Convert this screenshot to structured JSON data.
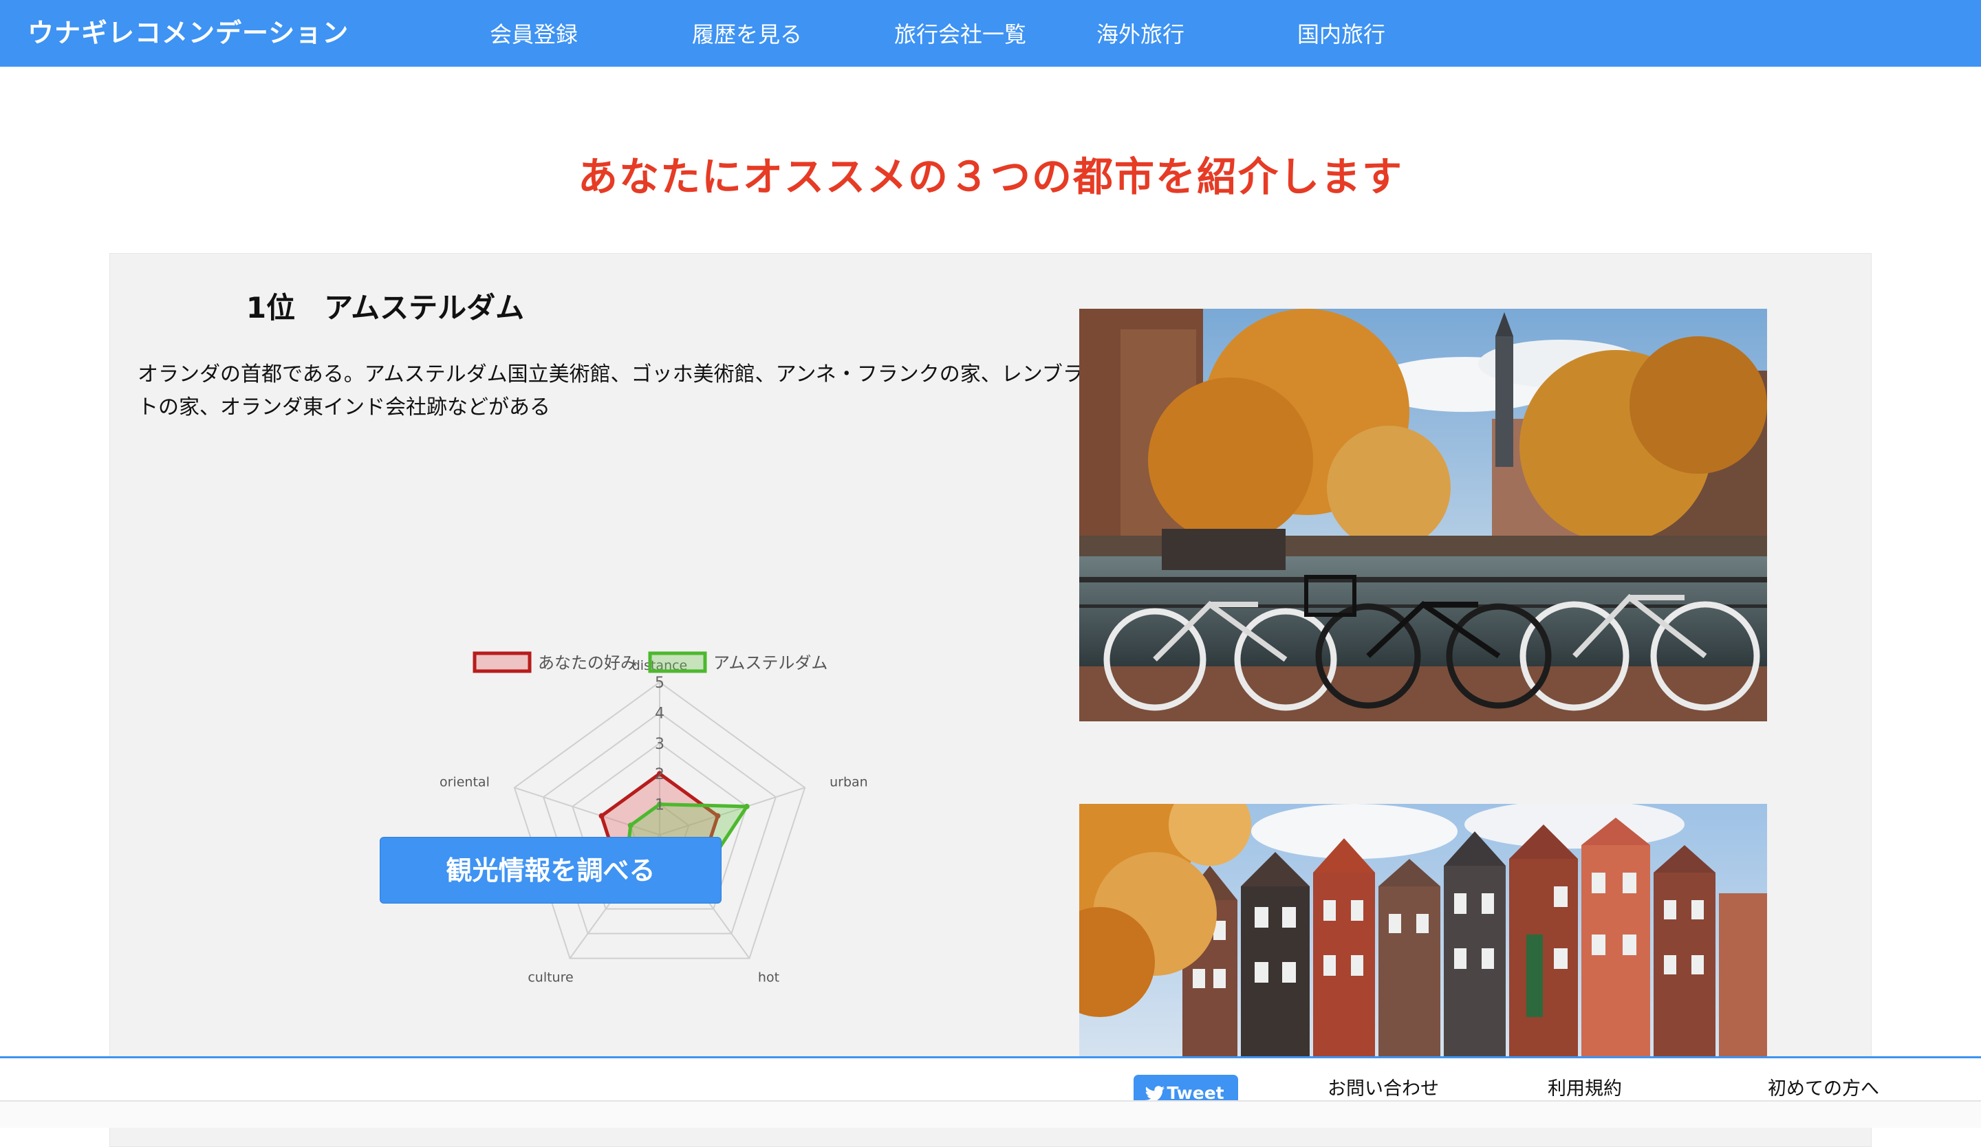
{
  "header": {
    "brand": "ウナギレコメンデーション",
    "nav": [
      "会員登録",
      "履歴を見る",
      "旅行会社一覧",
      "海外旅行",
      "国内旅行"
    ]
  },
  "headline": "あなたにオススメの３つの都市を紹介します",
  "recommendation": {
    "rank_title": "1位　アムステルダム",
    "description": "オランダの首都である。アムステルダム国立美術館、ゴッホ美術館、アンネ・フランクの家、レンブラントの家、オランダ東インド会社跡などがある",
    "cta_label": "観光情報を調べる",
    "photos": [
      "amsterdam-canal-bicycles",
      "amsterdam-canal-houses"
    ]
  },
  "chart_data": {
    "type": "radar",
    "axes": [
      "distance",
      "urban",
      "hot",
      "culture",
      "oriental"
    ],
    "ticks": [
      "1",
      "2",
      "3",
      "4",
      "5"
    ],
    "rmax": 5,
    "series": [
      {
        "name": "あなたの好み",
        "values": [
          2,
          2,
          2,
          2,
          2
        ],
        "stroke": "#b81c1c",
        "fill": "rgba(230,110,110,0.35)"
      },
      {
        "name": "アムステルダム",
        "values": [
          1,
          3,
          2,
          2,
          1
        ],
        "stroke": "#4db82e",
        "fill": "rgba(120,200,90,0.35)"
      }
    ]
  },
  "footer": {
    "tweet_label": "Tweet",
    "links": [
      "お問い合わせ",
      "利用規約",
      "初めての方へ"
    ]
  },
  "colors": {
    "brand_blue": "#3e93f3",
    "headline_red": "#e63b25"
  }
}
